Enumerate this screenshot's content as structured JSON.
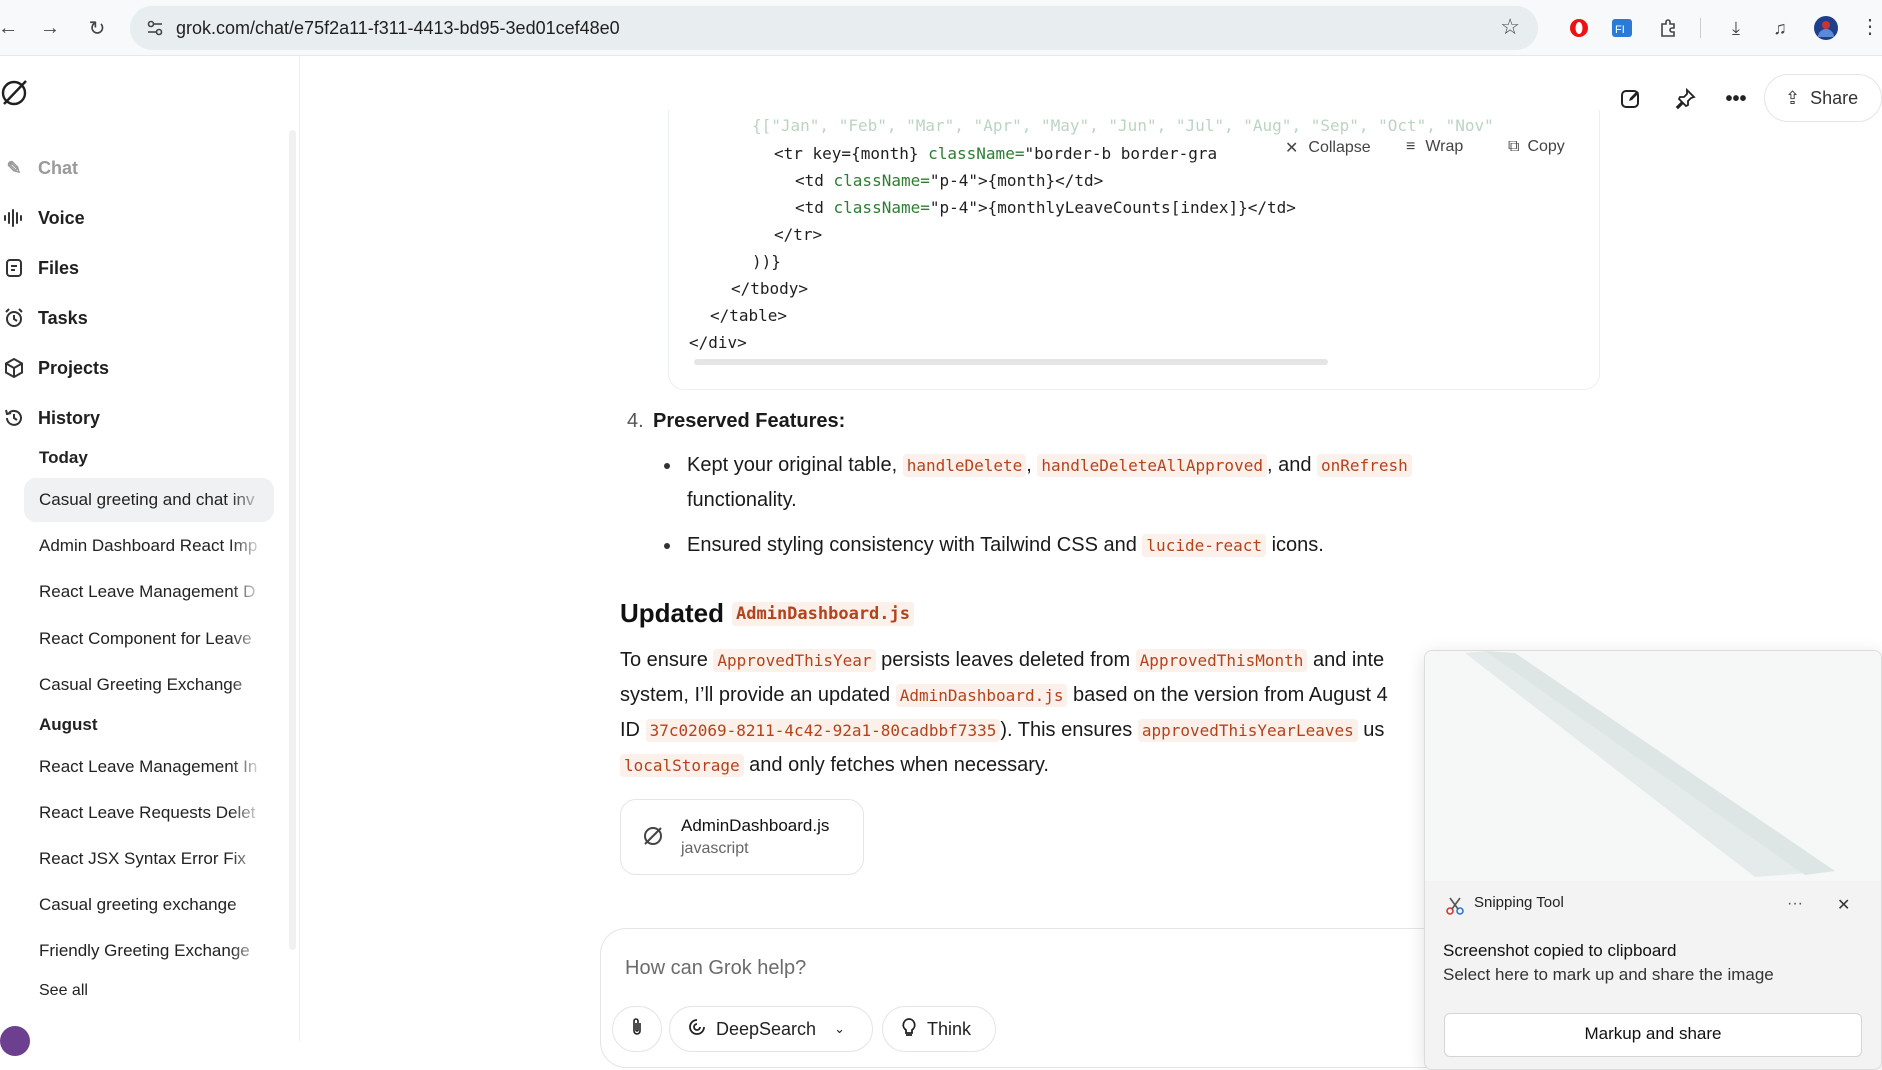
{
  "browser": {
    "url": "grok.com/chat/e75f2a11-f311-4413-bd95-3ed01cef48e0",
    "icons": [
      "back-arrow-icon",
      "forward-arrow-icon",
      "reload-icon",
      "site-settings-icon",
      "bookmark-star-icon",
      "opera-extension-icon",
      "fi-extension-icon",
      "puzzle-icon",
      "download-icon",
      "media-control-icon",
      "profile-avatar-icon"
    ]
  },
  "sidebar": {
    "nav": [
      {
        "label": "Chat",
        "icon": "chat-edit-icon"
      },
      {
        "label": "Voice",
        "icon": "voice-wave-icon"
      },
      {
        "label": "Files",
        "icon": "files-icon"
      },
      {
        "label": "Tasks",
        "icon": "alarm-clock-icon"
      },
      {
        "label": "Projects",
        "icon": "cube-icon"
      },
      {
        "label": "History",
        "icon": "history-icon"
      }
    ],
    "today_label": "Today",
    "today": [
      "Casual greeting and chat inv",
      "Admin Dashboard React Imp",
      "React Leave Management D",
      "React Component for Leave",
      "Casual Greeting Exchange"
    ],
    "august_label": "August",
    "august": [
      "React Leave Management In",
      "React Leave Requests Delet",
      "React JSX Syntax Error Fix",
      "Casual greeting exchange",
      "Friendly Greeting Exchange"
    ],
    "see_all": "See all"
  },
  "topbar": {
    "share_label": "Share"
  },
  "code": {
    "tools": {
      "collapse": "Collapse",
      "wrap": "Wrap",
      "copy": "Copy"
    },
    "line0": "{[\"Jan\", \"Feb\", \"Mar\", \"Apr\", \"May\", \"Jun\", \"Jul\", \"Aug\", \"Sep\", \"Oct\", \"Nov\"",
    "line1a": "<tr key={month} ",
    "line1b": "className=",
    "line1c": "\"border-b border-gra",
    "line2a": "<td ",
    "line2b": "className=",
    "line2c": "\"p-4\"",
    "line2d": ">{month}</td>",
    "line3a": "<td ",
    "line3b": "className=",
    "line3c": "\"p-4\"",
    "line3d": ">{monthlyLeaveCounts[index]}</td>",
    "line4": "</tr>",
    "line5": "))}",
    "line6": "</tbody>",
    "line7": "</table>",
    "line8": "</div>"
  },
  "answer": {
    "item_number": "4.",
    "item_title": "Preserved Features:",
    "bullet1_pre": "Kept your original table, ",
    "bullet1_code1": "handleDelete",
    "bullet1_sep": ",",
    "bullet1_code2": "handleDeleteAllApproved",
    "bullet1_and": ", and",
    "bullet1_code3": "onRefresh",
    "bullet1_cont": "functionality.",
    "bullet2_pre": "Ensured styling consistency with Tailwind CSS and",
    "bullet2_code": "lucide-react",
    "bullet2_post": "icons.",
    "heading_word": "Updated",
    "heading_code": "AdminDashboard.js",
    "p_l1_a": "To ensure",
    "p_l1_code1": "ApprovedThisYear",
    "p_l1_b": "persists leaves deleted from",
    "p_l1_code2": "ApprovedThisMonth",
    "p_l1_c": "and inte",
    "p_l2_a": "system, I’ll provide an updated",
    "p_l2_code": "AdminDashboard.js",
    "p_l2_b": "based on the version from August 4",
    "p_l3_a": "ID",
    "p_l3_code1": "37c02069-8211-4c42-92a1-80cadbbf7335",
    "p_l3_b": "). This ensures",
    "p_l3_code2": "approvedThisYearLeaves",
    "p_l3_c": "us",
    "p_l4_code": "localStorage",
    "p_l4_b": "and only fetches when necessary.",
    "file_name": "AdminDashboard.js",
    "file_lang": "javascript"
  },
  "composer": {
    "placeholder": "How can Grok help?",
    "deepsearch": "DeepSearch",
    "think": "Think"
  },
  "snipping": {
    "app": "Snipping Tool",
    "title": "Screenshot copied to clipboard",
    "subtitle": "Select here to mark up and share the image",
    "button": "Markup and share"
  }
}
